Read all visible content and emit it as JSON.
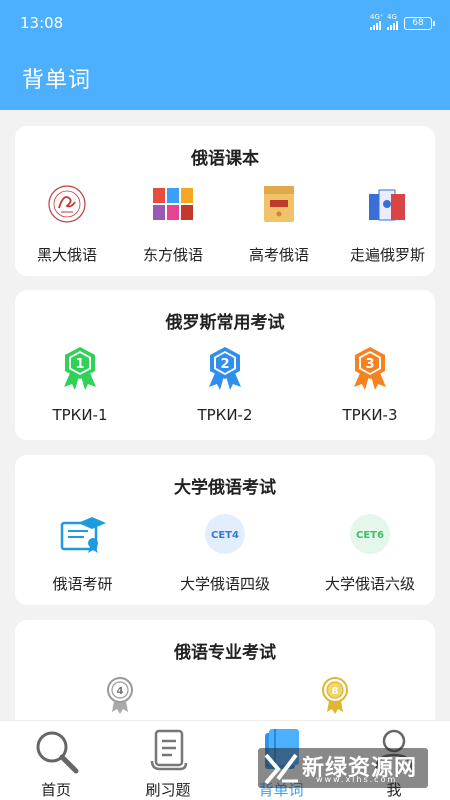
{
  "status": {
    "time": "13:08",
    "network_1": "4G⁺",
    "network_2": "4G",
    "battery": "68"
  },
  "app_bar": {
    "title": "背单词"
  },
  "colors": {
    "primary": "#4db0ff",
    "active_tab": "#3aa0f8",
    "badge_green": "#2fd158",
    "badge_blue": "#2f8ff0",
    "badge_orange": "#f58220"
  },
  "sections": [
    {
      "title": "俄语课本",
      "items": [
        {
          "label": "黑大俄语",
          "icon": "university-seal-icon"
        },
        {
          "label": "东方俄语",
          "icon": "textbook-set-icon"
        },
        {
          "label": "高考俄语",
          "icon": "envelope-icon"
        },
        {
          "label": "走遍俄罗斯",
          "icon": "book-stack-icon"
        }
      ]
    },
    {
      "title": "俄罗斯常用考试",
      "items": [
        {
          "label": "ТРКИ-1",
          "icon": "badge-1-icon",
          "number": "1"
        },
        {
          "label": "ТРКИ-2",
          "icon": "badge-2-icon",
          "number": "2"
        },
        {
          "label": "ТРКИ-3",
          "icon": "badge-3-icon",
          "number": "3"
        }
      ]
    },
    {
      "title": "大学俄语考试",
      "items": [
        {
          "label": "俄语考研",
          "icon": "certificate-icon"
        },
        {
          "label": "大学俄语四级",
          "icon": "cet4-icon",
          "badge_text": "CET4"
        },
        {
          "label": "大学俄语六级",
          "icon": "cet6-icon",
          "badge_text": "CET6"
        }
      ]
    },
    {
      "title": "俄语专业考试",
      "items": [
        {
          "label": "",
          "icon": "medal-4-icon",
          "number": "4"
        },
        {
          "label": "",
          "icon": "medal-8-icon",
          "number": "8"
        }
      ]
    }
  ],
  "nav": [
    {
      "label": "首页",
      "icon": "search-icon"
    },
    {
      "label": "刷习题",
      "icon": "scroll-icon"
    },
    {
      "label": "背单词",
      "icon": "book-icon",
      "active": true
    },
    {
      "label": "我",
      "icon": "user-icon"
    }
  ],
  "watermark": {
    "cn": "新绿资源网",
    "en": "www.xlhs.com"
  }
}
